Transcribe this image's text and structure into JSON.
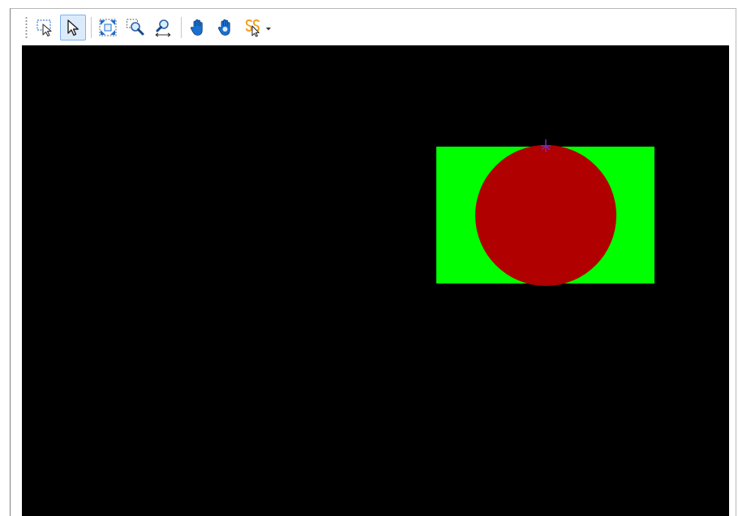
{
  "toolbar": {
    "tools": [
      {
        "name": "select-area-icon",
        "active": false
      },
      {
        "name": "pointer-icon",
        "active": true
      },
      {
        "name": "zoom-extents-icon",
        "active": false
      },
      {
        "name": "zoom-window-icon",
        "active": false
      },
      {
        "name": "zoom-horizontal-icon",
        "active": false
      },
      {
        "name": "pan-hand-icon",
        "active": false
      },
      {
        "name": "pan-hand-alt-icon",
        "active": false
      },
      {
        "name": "snap-tool-icon",
        "active": false
      }
    ]
  },
  "colors": {
    "canvas_background": "#000000",
    "rectangle_fill": "#00ff00",
    "circle_fill": "#b00000",
    "marker": "#7a2aa8",
    "accent_blue": "#1a6fd0"
  },
  "canvas": {
    "shapes": [
      "green-rectangle",
      "red-circle",
      "vertex-marker"
    ]
  }
}
